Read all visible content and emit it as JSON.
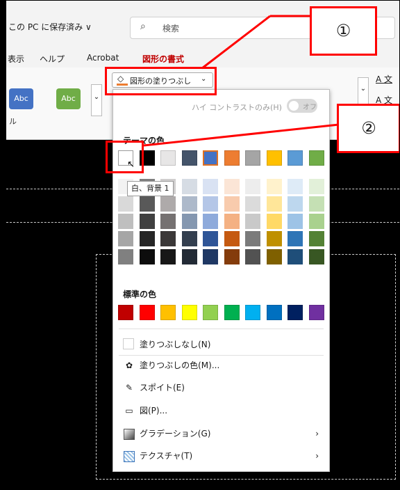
{
  "titlebar": {
    "save_status": "この PC に保存済み ∨",
    "search_placeholder": "検索"
  },
  "menubar": {
    "items": [
      "表示",
      "ヘルプ",
      "Acrobat",
      "図形の書式"
    ]
  },
  "ribbon": {
    "shape_styles": [
      {
        "label": "Abc",
        "color": "#4472c4"
      },
      {
        "label": "Abc",
        "color": "#70ad47"
      }
    ],
    "group_label": "ル",
    "fill_button": {
      "label": "図形の塗りつぶし",
      "chevron": "⌄"
    },
    "right_text_1": "文",
    "right_text_2": "文"
  },
  "dropdown": {
    "high_contrast_label": "ハイ コントラストのみ(H)",
    "toggle_text": "オフ",
    "theme_title": "テーマの色",
    "tooltip": "白、背景 1",
    "theme_colors": [
      "#ffffff",
      "#000000",
      "#e7e6e6",
      "#44546a",
      "#4472c4",
      "#ed7d31",
      "#a5a5a5",
      "#ffc000",
      "#5b9bd5",
      "#70ad47"
    ],
    "theme_tones": [
      [
        "#f2f2f2",
        "#d9d9d9",
        "#bfbfbf",
        "#a6a6a6",
        "#808080"
      ],
      [
        "#7f7f7f",
        "#595959",
        "#404040",
        "#262626",
        "#0d0d0d"
      ],
      [
        "#d0cece",
        "#aeaaaa",
        "#757171",
        "#3b3838",
        "#171717"
      ],
      [
        "#d6dce4",
        "#adb9ca",
        "#8497b0",
        "#333f4f",
        "#222a35"
      ],
      [
        "#d9e2f3",
        "#b4c6e7",
        "#8eaadb",
        "#2f5597",
        "#1f3864"
      ],
      [
        "#fbe5d6",
        "#f8cbad",
        "#f4b183",
        "#c55a11",
        "#843c0c"
      ],
      [
        "#ededed",
        "#dbdbdb",
        "#c9c9c9",
        "#7b7b7b",
        "#525252"
      ],
      [
        "#fff2cc",
        "#ffe699",
        "#ffd966",
        "#bf9000",
        "#7f6000"
      ],
      [
        "#deebf7",
        "#bdd7ee",
        "#9dc3e6",
        "#2e75b6",
        "#1f4e79"
      ],
      [
        "#e2f0d9",
        "#c5e0b4",
        "#a9d18e",
        "#548235",
        "#385723"
      ]
    ],
    "standard_title": "標準の色",
    "standard_colors": [
      "#c00000",
      "#ff0000",
      "#ffc000",
      "#ffff00",
      "#92d050",
      "#00b050",
      "#00b0f0",
      "#0070c0",
      "#002060",
      "#7030a0"
    ],
    "items": {
      "no_fill": "塗りつぶしなし(N)",
      "more_colors": "塗りつぶしの色(M)...",
      "eyedropper": "スポイト(E)",
      "picture": "図(P)...",
      "gradient": "グラデーション(G)",
      "texture": "テクスチャ(T)",
      "arrow": "›"
    }
  },
  "annotations": {
    "callout_1": "①",
    "callout_2": "②"
  },
  "icons": {
    "search": "⌕",
    "paint_bucket": "🪣",
    "palette": "🎨",
    "eyedropper": "✎",
    "picture": "🖼",
    "cursor": "↖"
  },
  "accent_colors": {
    "highlight": "#ff0000",
    "selected_swatch_border": "#e07020",
    "active_menu": "#c00000"
  }
}
